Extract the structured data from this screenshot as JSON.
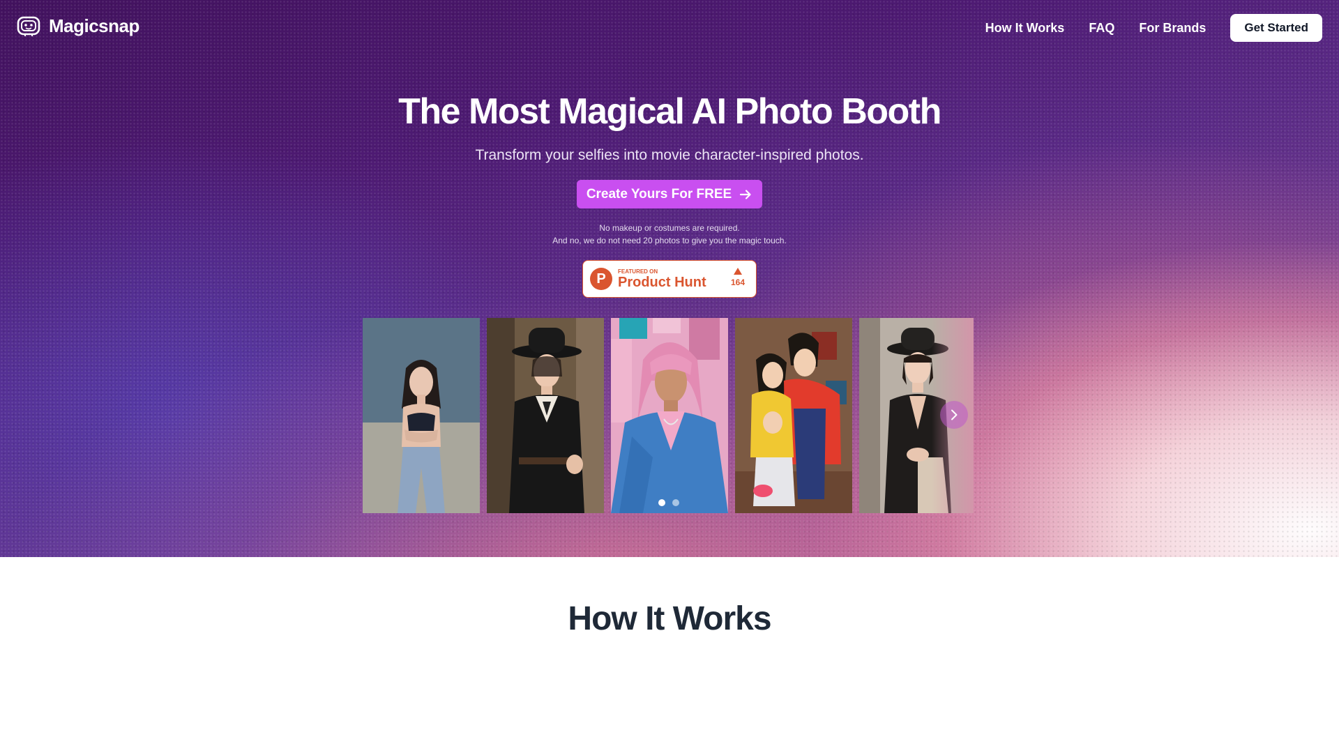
{
  "brand": {
    "name": "Magicsnap",
    "icon": "robot-face-icon"
  },
  "nav": {
    "links": [
      "How It Works",
      "FAQ",
      "For Brands"
    ],
    "cta": "Get Started"
  },
  "hero": {
    "title": "The Most Magical AI Photo Booth",
    "subtitle": "Transform your selfies into movie character-inspired photos.",
    "cta": "Create Yours For FREE",
    "cta_icon": "arrow-right-icon",
    "note_line1": "No makeup or costumes are required.",
    "note_line2": "And no, we do not need 20 photos to give you the magic touch."
  },
  "product_hunt": {
    "featured": "FEATURED ON",
    "name": "Product Hunt",
    "logo_letter": "P",
    "votes": "164"
  },
  "carousel": {
    "slides": [
      "portrait-denim-girl",
      "portrait-hat-suit-woman",
      "portrait-pink-hair-man",
      "portrait-anime-couple",
      "portrait-black-dress-woman"
    ],
    "dots": 2,
    "active_dot": 1,
    "next_icon": "chevron-right-icon"
  },
  "how_it_works": {
    "title": "How It Works"
  },
  "colors": {
    "accent": "#c94ff0",
    "product_hunt": "#da552f",
    "hero_top": "#42125e"
  }
}
